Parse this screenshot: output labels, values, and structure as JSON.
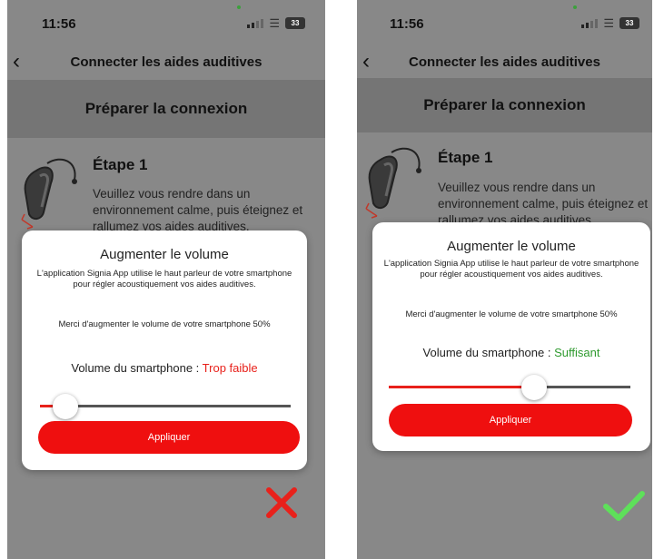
{
  "screens": [
    {
      "status_time": "11:56",
      "battery": "33",
      "nav_title": "Connecter les aides auditives",
      "section_title": "Préparer la connexion",
      "step_title": "Étape 1",
      "step_text": "Veuillez vous rendre dans un environnement calme, puis éteignez et rallumez vos aides auditives.",
      "dialog_title": "Augmenter le volume",
      "dialog_body": "L'application Signia App utilise le haut parleur de votre smartphone pour régler acoustiquement vos aides auditives.",
      "dialog_instruction": "Merci d'augmenter le volume de votre smartphone 50%",
      "volume_label": "Volume du smartphone : ",
      "volume_status": "Trop faible",
      "slider_value": 0.1,
      "apply_label": "Appliquer",
      "result_icon": "cross-icon",
      "result_color": "#e8211b"
    },
    {
      "status_time": "11:56",
      "battery": "33",
      "nav_title": "Connecter les aides auditives",
      "section_title": "Préparer la connexion",
      "step_title": "Étape 1",
      "step_text": "Veuillez vous rendre dans un environnement calme, puis éteignez et rallumez vos aides auditives.",
      "dialog_title": "Augmenter le volume",
      "dialog_body": "L'application Signia App utilise le haut parleur de votre smartphone pour régler acoustiquement vos aides auditives.",
      "dialog_instruction": "Merci d'augmenter le volume de votre smartphone 50%",
      "volume_label": "Volume du smartphone : ",
      "volume_status": "Suffisant",
      "slider_value": 0.6,
      "apply_label": "Appliquer",
      "result_icon": "check-icon",
      "result_color": "#5ee05a"
    }
  ]
}
